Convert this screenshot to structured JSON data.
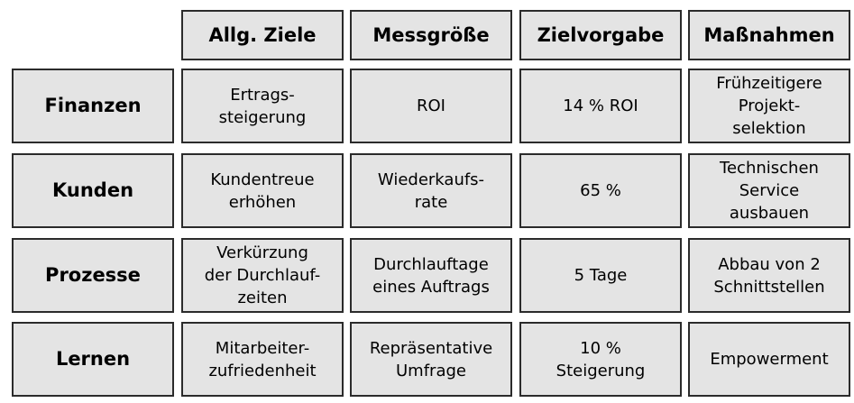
{
  "columns": [
    "Allg. Ziele",
    "Messgröße",
    "Zielvorgabe",
    "Maßnahmen"
  ],
  "rows": [
    {
      "label": "Finanzen",
      "cells": [
        "Ertrags-\nsteigerung",
        "ROI",
        "14 % ROI",
        "Frühzeitigere\nProjekt-\nselektion"
      ]
    },
    {
      "label": "Kunden",
      "cells": [
        "Kundentreue\nerhöhen",
        "Wiederkaufs-\nrate",
        "65 %",
        "Technischen\nService\nausbauen"
      ]
    },
    {
      "label": "Prozesse",
      "cells": [
        "Verkürzung\nder Durchlauf-\nzeiten",
        "Durchlauftage\neines Auftrags",
        "5 Tage",
        "Abbau von 2\nSchnittstellen"
      ]
    },
    {
      "label": "Lernen",
      "cells": [
        "Mitarbeiter-\nzufriedenheit",
        "Repräsentative\nUmfrage",
        "10 %\nSteigerung",
        "Empowerment"
      ]
    }
  ],
  "colors": {
    "cell_fill": "#e4e4e4",
    "border": "#2b2b2b",
    "text": "#000000"
  }
}
